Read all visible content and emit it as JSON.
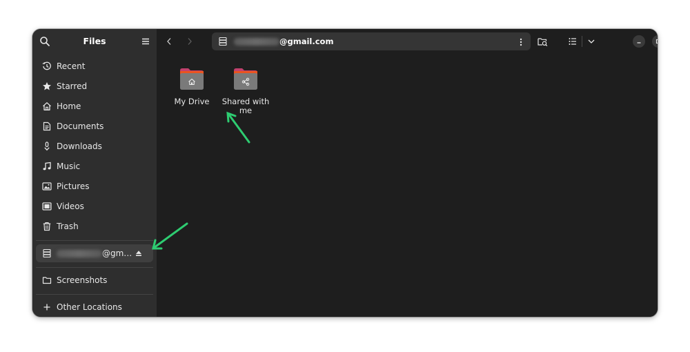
{
  "sidebar": {
    "title": "Files",
    "places": [
      {
        "label": "Recent",
        "icon": "clock-icon"
      },
      {
        "label": "Starred",
        "icon": "star-icon"
      },
      {
        "label": "Home",
        "icon": "home-icon"
      },
      {
        "label": "Documents",
        "icon": "document-icon"
      },
      {
        "label": "Downloads",
        "icon": "download-icon"
      },
      {
        "label": "Music",
        "icon": "music-icon"
      },
      {
        "label": "Pictures",
        "icon": "picture-icon"
      },
      {
        "label": "Videos",
        "icon": "video-icon"
      },
      {
        "label": "Trash",
        "icon": "trash-icon"
      }
    ],
    "mount": {
      "label_suffix": "@gm…"
    },
    "bookmarks": [
      {
        "label": "Screenshots",
        "icon": "folder-icon"
      }
    ],
    "other_locations": {
      "label": "Other Locations"
    }
  },
  "header": {
    "path_suffix": "@gmail.com"
  },
  "content": {
    "items": [
      {
        "label": "My Drive",
        "badge": "home-icon"
      },
      {
        "label": "Shared with me",
        "badge": "share-icon"
      }
    ]
  },
  "colors": {
    "accent_arrow": "#2ecc71",
    "folder_top": "#e95420",
    "folder_body": "#7a7a7a"
  }
}
